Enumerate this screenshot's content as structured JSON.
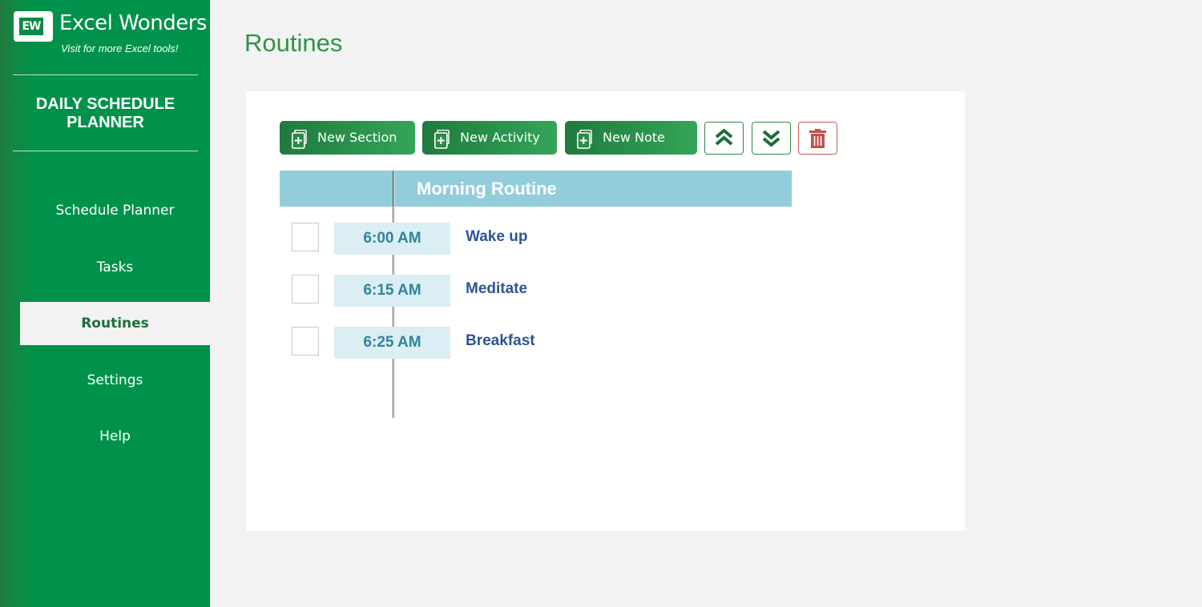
{
  "brand": {
    "logo_text": "EW",
    "name": "Excel Wonders",
    "tagline": "Visit for more Excel tools!"
  },
  "sidebar": {
    "app_title": "DAILY SCHEDULE PLANNER",
    "items": [
      {
        "label": "Schedule Planner",
        "active": false
      },
      {
        "label": "Tasks",
        "active": false
      },
      {
        "label": "Routines",
        "active": true
      },
      {
        "label": "Settings",
        "active": false
      },
      {
        "label": "Help",
        "active": false
      }
    ]
  },
  "page": {
    "title": "Routines"
  },
  "toolbar": {
    "new_section_label": "New Section",
    "new_activity_label": "New Activity",
    "new_note_label": "New Note",
    "move_up_icon": "double-chevron-up-icon",
    "move_down_icon": "double-chevron-down-icon",
    "delete_icon": "trash-icon"
  },
  "routine": {
    "section_title": "Morning Routine",
    "activities": [
      {
        "time": "6:00 AM",
        "name": "Wake up",
        "checked": false
      },
      {
        "time": "6:15 AM",
        "name": "Meditate",
        "checked": false
      },
      {
        "time": "6:25 AM",
        "name": "Breakfast",
        "checked": false
      }
    ]
  },
  "colors": {
    "sidebar_green": "#00924a",
    "title_green": "#2e9448",
    "section_header": "#92cddc",
    "time_cell": "#daeef3",
    "time_text": "#31859c",
    "activity_text": "#2f5495",
    "delete_red": "#c0504d"
  }
}
